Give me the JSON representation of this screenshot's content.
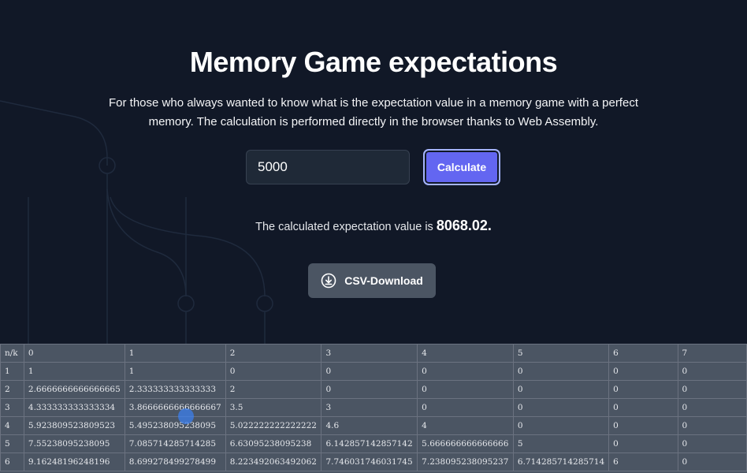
{
  "page": {
    "title": "Memory Game expectations",
    "intro": "For those who always wanted to know what is the expectation value in a memory game with a perfect memory. The calculation is performed directly in the browser thanks to Web Assembly."
  },
  "form": {
    "input_value": "5000",
    "calculate_label": "Calculate"
  },
  "result": {
    "prefix": "The calculated expectation value is",
    "value": "8068.02."
  },
  "csv": {
    "label": "CSV-Download",
    "icon": "download-circle-icon"
  },
  "table": {
    "header": [
      "n/k",
      "0",
      "1",
      "2",
      "3",
      "4",
      "5",
      "6",
      "7"
    ],
    "rows": [
      [
        "1",
        "1",
        "1",
        "0",
        "0",
        "0",
        "0",
        "0",
        "0"
      ],
      [
        "2",
        "2.6666666666666665",
        "2.333333333333333",
        "2",
        "0",
        "0",
        "0",
        "0",
        "0"
      ],
      [
        "3",
        "4.333333333333334",
        "3.8666666666666667",
        "3.5",
        "3",
        "0",
        "0",
        "0",
        "0"
      ],
      [
        "4",
        "5.923809523809523",
        "5.495238095238095",
        "5.022222222222222",
        "4.6",
        "4",
        "0",
        "0",
        "0"
      ],
      [
        "5",
        "7.55238095238095",
        "7.085714285714285",
        "6.63095238095238",
        "6.142857142857142",
        "5.666666666666666",
        "5",
        "0",
        "0"
      ],
      [
        "6",
        "9.16248196248196",
        "8.699278499278499",
        "8.223492063492062",
        "7.746031746031745",
        "7.238095238095237",
        "6.714285714285714",
        "6",
        "0"
      ]
    ]
  },
  "colors": {
    "background": "#111827",
    "accent": "#6366f1",
    "secondary_button": "#4b5563",
    "table_bg": "#4b5563"
  }
}
